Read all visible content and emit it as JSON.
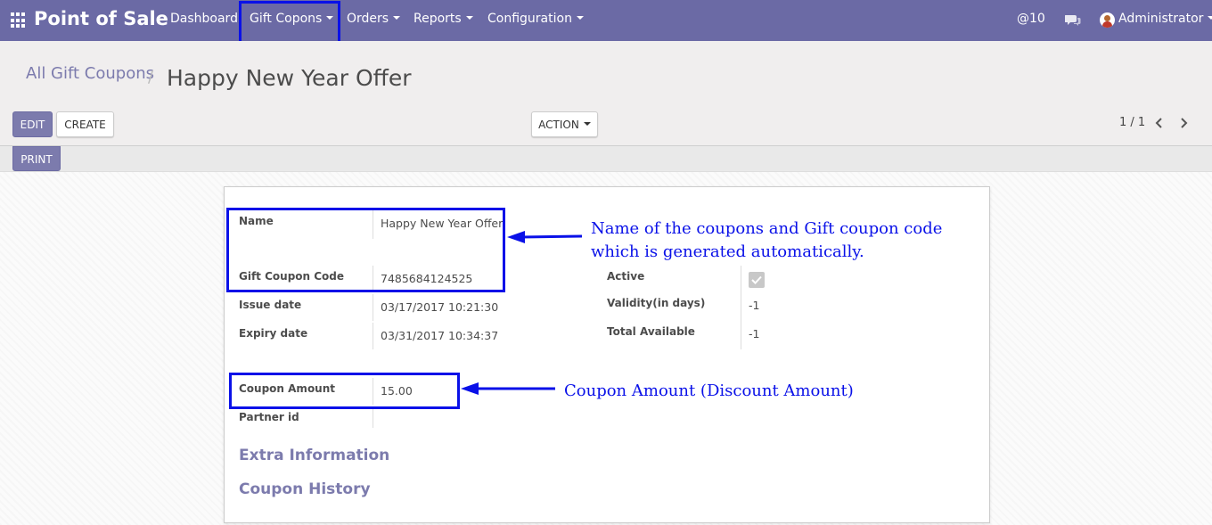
{
  "navbar": {
    "brand": "Point of Sale",
    "menu": [
      {
        "label": "Dashboard"
      },
      {
        "label": "Gift Copons"
      },
      {
        "label": "Orders"
      },
      {
        "label": "Reports"
      },
      {
        "label": "Configuration"
      }
    ],
    "mentions_count": "@10",
    "user": "Administrator"
  },
  "breadcrumb": {
    "parent": "All Gift Coupons",
    "separator": "/",
    "current": "Happy New Year Offer"
  },
  "toolbar": {
    "edit_label": "EDIT",
    "create_label": "CREATE",
    "action_label": "ACTION",
    "print_label": "PRINT",
    "pager": "1 / 1"
  },
  "form": {
    "left": {
      "name_label": "Name",
      "name_value": "Happy New Year Offer",
      "code_label": "Gift Coupon Code",
      "code_value": "7485684124525",
      "issue_label": "Issue date",
      "issue_value": "03/17/2017 10:21:30",
      "expiry_label": "Expiry date",
      "expiry_value": "03/31/2017 10:34:37",
      "amount_label": "Coupon Amount",
      "amount_value": "15.00",
      "partner_label": "Partner id",
      "partner_value": ""
    },
    "right": {
      "active_label": "Active",
      "active_checked": true,
      "validity_label": "Validity(in days)",
      "validity_value": "-1",
      "total_label": "Total Available",
      "total_value": "-1"
    },
    "sections": {
      "extra": "Extra Information",
      "history": "Coupon History"
    }
  },
  "annotations": {
    "name_note_line1": "Name of the coupons and Gift coupon code",
    "name_note_line2": "which is generated automatically.",
    "amount_note": "Coupon Amount (Discount Amount)"
  },
  "colors": {
    "navbar": "#6b6aa5",
    "primary": "#7c7bad",
    "annotation": "#0a11e8"
  }
}
